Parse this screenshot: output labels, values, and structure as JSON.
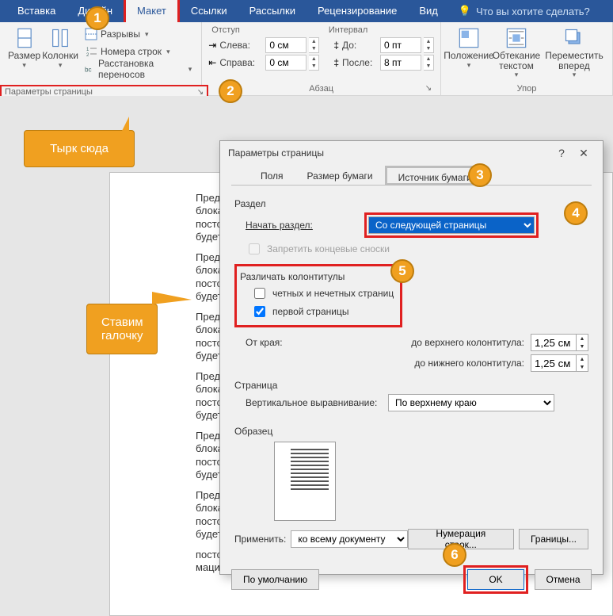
{
  "ribbon": {
    "tabs": [
      "Вставка",
      "Дизайн",
      "Макет",
      "Ссылки",
      "Рассылки",
      "Рецензирование",
      "Вид"
    ],
    "active_tab_index": 2,
    "tell_me": "Что вы хотите сделать?",
    "size": "Размер",
    "columns": "Колонки",
    "breaks": "Разрывы",
    "line_numbers": "Номера строк",
    "hyphenation": "Расстановка переносов",
    "page_setup_group": "Параметры страницы",
    "indent_group": "Отступ",
    "indent_left": "Слева:",
    "indent_left_val": "0 см",
    "indent_right": "Справа:",
    "indent_right_val": "0 см",
    "spacing_group": "Интервал",
    "spacing_before": "До:",
    "spacing_before_val": "0 пт",
    "spacing_after": "После:",
    "spacing_after_val": "8 пт",
    "paragraph_group": "Абзац",
    "position": "Положение",
    "wrap_text": "Обтекание текстом",
    "bring_forward": "Переместить вперед",
    "arrange_group": "Упор"
  },
  "callouts": {
    "n1": "1",
    "n2": "2",
    "n3": "3",
    "n4": "4",
    "n5": "5",
    "n6": "6",
    "tyrk": "Тырк сюда",
    "check": "Ставим галочку"
  },
  "dialog": {
    "title": "Параметры страницы",
    "tabs": {
      "fields": "Поля",
      "paper_size": "Размер бумаги",
      "paper_source": "Источник бумаги"
    },
    "section": "Раздел",
    "section_start": "Начать раздел:",
    "section_start_val": "Со следующей страницы",
    "suppress_endnotes": "Запретить концевые сноски",
    "headers_footers": "Различать колонтитулы",
    "diff_odd_even": "четных и нечетных страниц",
    "diff_first": "первой страницы",
    "from_edge": "От края:",
    "to_header": "до верхнего колонтитула:",
    "to_header_val": "1,25 см",
    "to_footer": "до нижнего колонтитула:",
    "to_footer_val": "1,25 см",
    "page": "Страница",
    "vert_align": "Вертикальное выравнивание:",
    "vert_align_val": "По верхнему краю",
    "preview": "Образец",
    "apply_to": "Применить:",
    "apply_to_val": "ко всему документу",
    "line_numbers_btn": "Нумерация строк...",
    "borders_btn": "Границы...",
    "default_btn": "По умолчанию",
    "ok": "OK",
    "cancel": "Отмена"
  },
  "doc": {
    "p": "Пред\nблока\nпосто\nбудет",
    "last": "постоянным. А сейчас для более полного заполнения блока текстовой инфор мацией"
  }
}
